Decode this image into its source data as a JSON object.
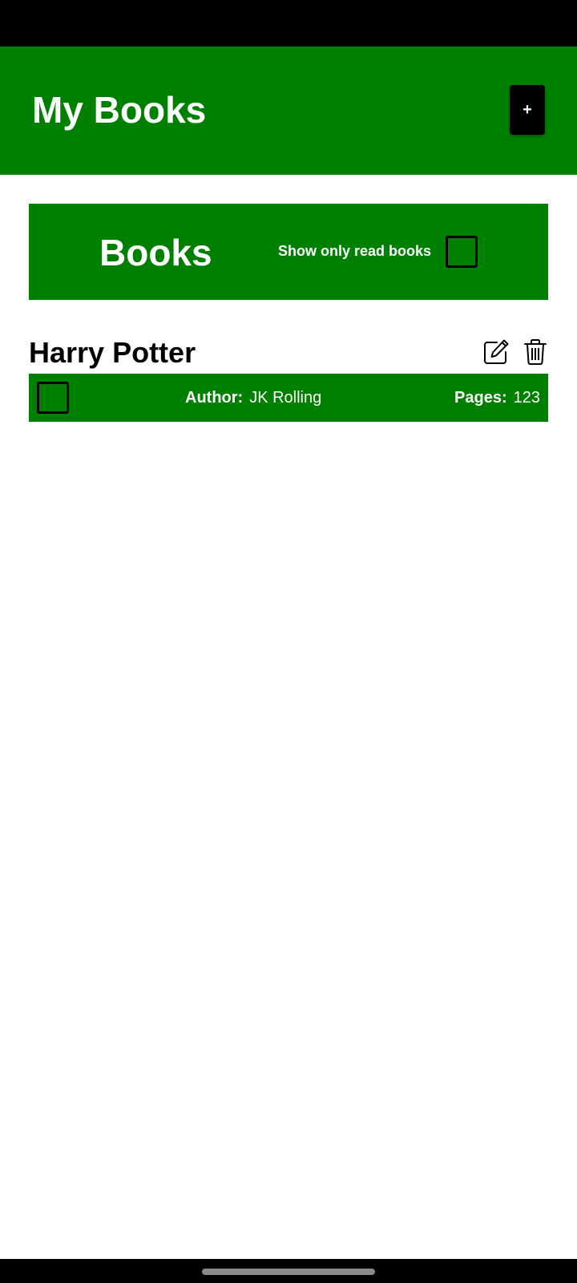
{
  "header": {
    "title": "My Books",
    "add_label": "+"
  },
  "filter": {
    "title": "Books",
    "toggle_label": "Show only read books",
    "toggle_checked": false
  },
  "books": [
    {
      "title": "Harry Potter",
      "read": false,
      "author_label": "Author:",
      "author": "JK Rolling",
      "pages_label": "Pages:",
      "pages": "123"
    }
  ],
  "icons": {
    "edit": "edit-icon",
    "delete": "trash-icon"
  },
  "colors": {
    "primary": "#008000",
    "text_on_primary": "#ffffff",
    "system_bars": "#000000"
  }
}
